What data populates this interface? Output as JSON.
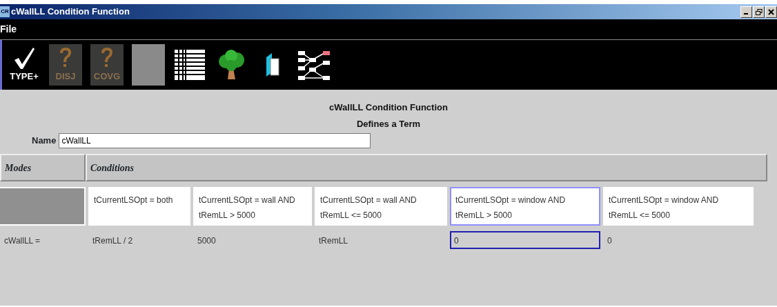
{
  "window": {
    "title": "cWallLL Condition Function",
    "app_badge": "CR"
  },
  "menu": [
    "File"
  ],
  "toolbar": [
    {
      "kind": "check",
      "label": "TYPE+",
      "disabled": false
    },
    {
      "kind": "question",
      "label": "DISJ",
      "disabled": true
    },
    {
      "kind": "question",
      "label": "COVG",
      "disabled": true
    },
    {
      "kind": "blank",
      "disabled": true
    },
    {
      "kind": "table",
      "disabled": false
    },
    {
      "kind": "tree",
      "disabled": false
    },
    {
      "kind": "book",
      "disabled": false
    },
    {
      "kind": "network",
      "disabled": false
    }
  ],
  "header": {
    "title": "cWallLL Condition Function",
    "subtitle": "Defines a Term"
  },
  "name_field": {
    "label": "Name",
    "value": "cWallLL"
  },
  "table": {
    "modes_heading": "Modes",
    "conditions_heading": "Conditions",
    "conditions": [
      {
        "line1": "tCurrentLSOpt = both",
        "selected": false
      },
      {
        "line1": "tCurrentLSOpt = wall AND",
        "line2": "tRemLL > 5000",
        "selected": false
      },
      {
        "line1": "tCurrentLSOpt = wall AND",
        "line2": "tRemLL <= 5000",
        "selected": false
      },
      {
        "line1": "tCurrentLSOpt = window AND",
        "line2": "tRemLL > 5000",
        "selected": true
      },
      {
        "line1": "tCurrentLSOpt = window AND",
        "line2": "tRemLL <= 5000",
        "selected": false
      }
    ],
    "row_label": "cWallLL =",
    "values": [
      {
        "text": "tRemLL / 2",
        "selected": false
      },
      {
        "text": "5000",
        "selected": false
      },
      {
        "text": "tRemLL",
        "selected": false
      },
      {
        "text": "0",
        "selected": true
      },
      {
        "text": "0",
        "selected": false
      }
    ]
  }
}
